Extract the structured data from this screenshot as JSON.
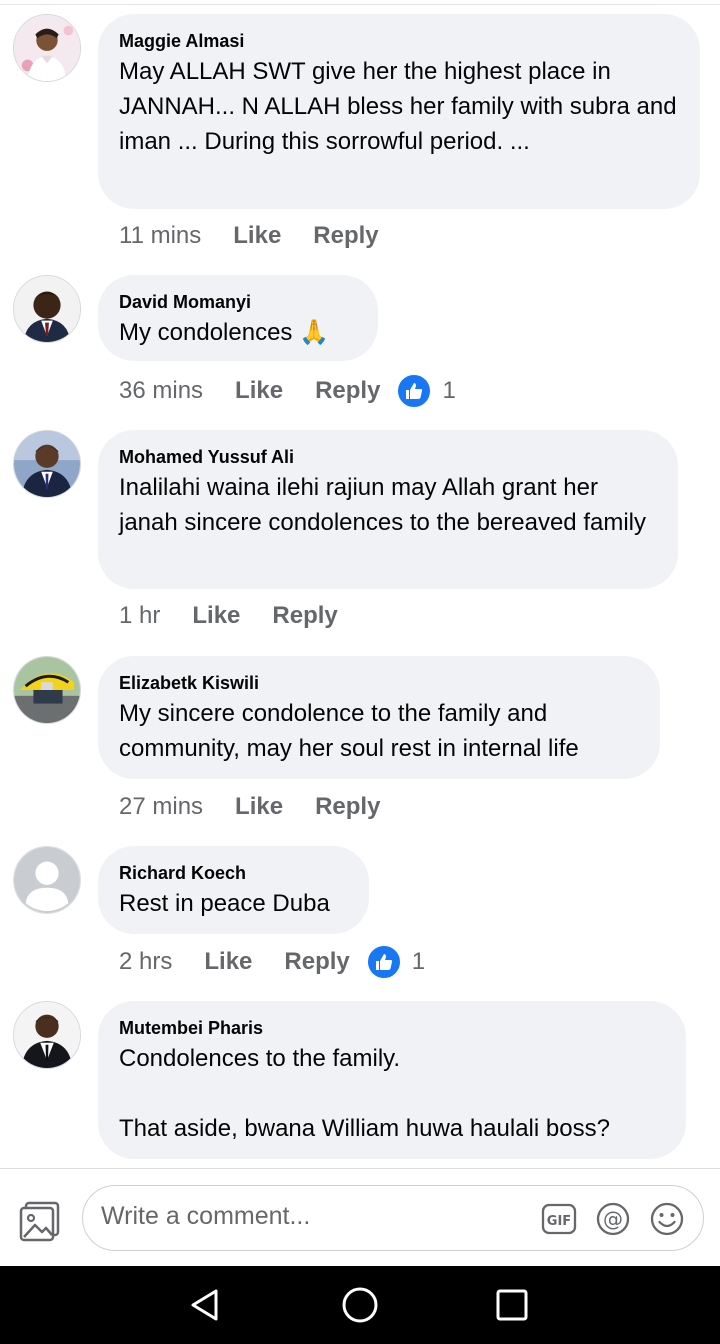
{
  "comments": [
    {
      "author": "Maggie Almasi",
      "text": "May ALLAH SWT give her the highest place in JANNAH... N ALLAH bless her family with subra and iman ... During this sorrowful period. ...",
      "time": "11 mins",
      "like_label": "Like",
      "reply_label": "Reply"
    },
    {
      "author": "David Momanyi",
      "text": "My condolences 🙏",
      "time": "36 mins",
      "like_label": "Like",
      "reply_label": "Reply",
      "reaction_count": "1"
    },
    {
      "author": "Mohamed Yussuf Ali",
      "text": "Inalilahi waina ilehi rajiun may Allah grant her janah sincere condolences to the bereaved family",
      "time": "1 hr",
      "like_label": "Like",
      "reply_label": "Reply"
    },
    {
      "author": "Elizabetk Kiswili",
      "text": "My sincere condolence to the family and community, may her soul rest in internal life",
      "time": "27 mins",
      "like_label": "Like",
      "reply_label": "Reply"
    },
    {
      "author": "Richard Koech",
      "text": "Rest in peace Duba",
      "time": "2 hrs",
      "like_label": "Like",
      "reply_label": "Reply",
      "reaction_count": "1"
    },
    {
      "author": "Mutembei Pharis",
      "text": "Condolences to the family.\n\nThat aside, bwana William huwa haulali boss?",
      "time": "",
      "like_label": "",
      "reply_label": ""
    }
  ],
  "composer": {
    "placeholder": "Write a comment...",
    "icons": [
      "photo-icon",
      "gif-icon",
      "mention-icon",
      "emoji-icon"
    ]
  },
  "navbar": {
    "icons": [
      "back-icon",
      "home-icon",
      "recents-icon"
    ]
  },
  "colors": {
    "bubble": "#f0f2f5",
    "like_blue": "#1877f2",
    "meta_gray": "#65676b",
    "nav_black": "#000000"
  }
}
